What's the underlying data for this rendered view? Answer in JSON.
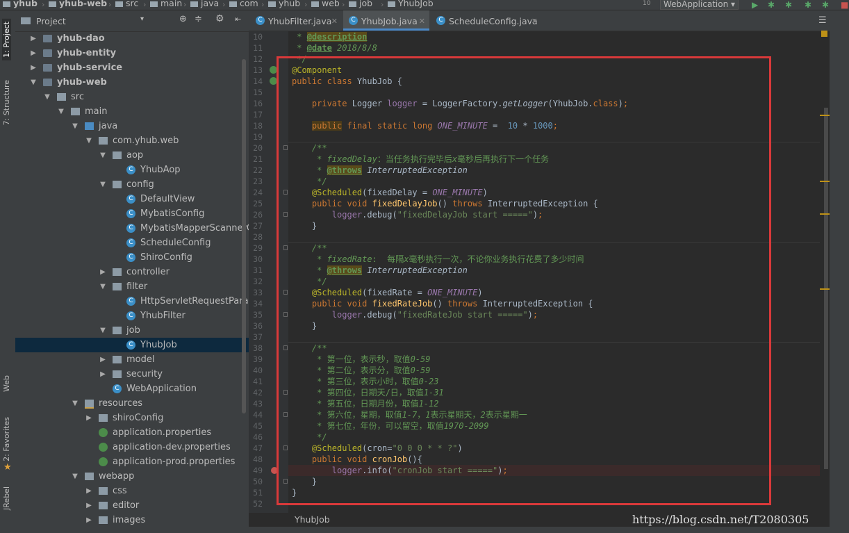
{
  "breadcrumbs": [
    {
      "label": "yhub",
      "bold": true
    },
    {
      "label": "yhub-web",
      "bold": true
    },
    {
      "label": "src",
      "bold": false
    },
    {
      "label": "main",
      "bold": false
    },
    {
      "label": "java",
      "bold": false
    },
    {
      "label": "com",
      "bold": false
    },
    {
      "label": "yhub",
      "bold": false
    },
    {
      "label": "web",
      "bold": false
    },
    {
      "label": "job",
      "bold": false
    },
    {
      "label": "YhubJob",
      "bold": false
    }
  ],
  "run_config": "WebApplication",
  "left_tool_tabs": [
    "1: Project",
    "7: Structure",
    "Web",
    "2: Favorites",
    "JRebel"
  ],
  "project_panel": {
    "title": "Project",
    "tree": [
      {
        "label": "yhub-dao",
        "indent": 0,
        "arrow": "right",
        "icon": "mod",
        "bold": true
      },
      {
        "label": "yhub-entity",
        "indent": 0,
        "arrow": "right",
        "icon": "mod",
        "bold": true
      },
      {
        "label": "yhub-service",
        "indent": 0,
        "arrow": "right",
        "icon": "mod",
        "bold": true
      },
      {
        "label": "yhub-web",
        "indent": 0,
        "arrow": "down",
        "icon": "mod",
        "bold": true
      },
      {
        "label": "src",
        "indent": 1,
        "arrow": "down",
        "icon": "fold",
        "bold": false
      },
      {
        "label": "main",
        "indent": 2,
        "arrow": "down",
        "icon": "fold",
        "bold": false
      },
      {
        "label": "java",
        "indent": 3,
        "arrow": "down",
        "icon": "src",
        "bold": false
      },
      {
        "label": "com.yhub.web",
        "indent": 4,
        "arrow": "down",
        "icon": "pkg",
        "bold": false
      },
      {
        "label": "aop",
        "indent": 5,
        "arrow": "down",
        "icon": "pkg",
        "bold": false
      },
      {
        "label": "YhubAop",
        "indent": 6,
        "arrow": "",
        "icon": "cls",
        "bold": false
      },
      {
        "label": "config",
        "indent": 5,
        "arrow": "down",
        "icon": "pkg",
        "bold": false
      },
      {
        "label": "DefaultView",
        "indent": 6,
        "arrow": "",
        "icon": "cls",
        "bold": false
      },
      {
        "label": "MybatisConfig",
        "indent": 6,
        "arrow": "",
        "icon": "cls",
        "bold": false
      },
      {
        "label": "MybatisMapperScannerCo",
        "indent": 6,
        "arrow": "",
        "icon": "cls",
        "bold": false
      },
      {
        "label": "ScheduleConfig",
        "indent": 6,
        "arrow": "",
        "icon": "cls",
        "bold": false
      },
      {
        "label": "ShiroConfig",
        "indent": 6,
        "arrow": "",
        "icon": "cls",
        "bold": false
      },
      {
        "label": "controller",
        "indent": 5,
        "arrow": "right",
        "icon": "pkg",
        "bold": false
      },
      {
        "label": "filter",
        "indent": 5,
        "arrow": "down",
        "icon": "pkg",
        "bold": false
      },
      {
        "label": "HttpServletRequestParame",
        "indent": 6,
        "arrow": "",
        "icon": "cls",
        "bold": false
      },
      {
        "label": "YhubFilter",
        "indent": 6,
        "arrow": "",
        "icon": "cls",
        "bold": false
      },
      {
        "label": "job",
        "indent": 5,
        "arrow": "down",
        "icon": "pkg",
        "bold": false
      },
      {
        "label": "YhubJob",
        "indent": 6,
        "arrow": "",
        "icon": "cls",
        "bold": false,
        "selected": true
      },
      {
        "label": "model",
        "indent": 5,
        "arrow": "right",
        "icon": "pkg",
        "bold": false
      },
      {
        "label": "security",
        "indent": 5,
        "arrow": "right",
        "icon": "pkg",
        "bold": false
      },
      {
        "label": "WebApplication",
        "indent": 5,
        "arrow": "",
        "icon": "cls",
        "bold": false
      },
      {
        "label": "resources",
        "indent": 3,
        "arrow": "down",
        "icon": "res",
        "bold": false
      },
      {
        "label": "shiroConfig",
        "indent": 4,
        "arrow": "right",
        "icon": "fold",
        "bold": false
      },
      {
        "label": "application.properties",
        "indent": 4,
        "arrow": "",
        "icon": "prop",
        "bold": false
      },
      {
        "label": "application-dev.properties",
        "indent": 4,
        "arrow": "",
        "icon": "prop",
        "bold": false
      },
      {
        "label": "application-prod.properties",
        "indent": 4,
        "arrow": "",
        "icon": "prop",
        "bold": false
      },
      {
        "label": "webapp",
        "indent": 3,
        "arrow": "down",
        "icon": "fold",
        "bold": false
      },
      {
        "label": "css",
        "indent": 4,
        "arrow": "right",
        "icon": "fold",
        "bold": false
      },
      {
        "label": "editor",
        "indent": 4,
        "arrow": "right",
        "icon": "fold",
        "bold": false
      },
      {
        "label": "images",
        "indent": 4,
        "arrow": "right",
        "icon": "fold",
        "bold": false
      }
    ]
  },
  "editor_tabs": [
    {
      "label": "YhubFilter.java",
      "active": false
    },
    {
      "label": "YhubJob.java",
      "active": true
    },
    {
      "label": "ScheduleConfig.java",
      "active": false
    }
  ],
  "code_lines": [
    {
      "n": 10,
      "html": "<span class=\"cmt\"> * </span><span class=\"tag\">@description</span>"
    },
    {
      "n": 11,
      "html": "<span class=\"cmt\"> * </span><span class=\"tag\" style=\"background:none\">@date</span><span class=\"cmt\"> 2018/8/8</span>"
    },
    {
      "n": 12,
      "html": "<span class=\"cmt\"> */</span>"
    },
    {
      "n": 13,
      "html": "<span class=\"ann\">@Component</span>"
    },
    {
      "n": 14,
      "html": "<span class=\"kw\">public class </span>YhubJob {"
    },
    {
      "n": 15,
      "html": ""
    },
    {
      "n": 16,
      "html": "    <span class=\"kw\">private </span>Logger <span class=\"fld\">logger</span> = LoggerFactory.<span class=\"it\">getLogger</span>(YhubJob.<span class=\"kw\">class</span>)<span class=\"kw\">;</span>"
    },
    {
      "n": 17,
      "html": ""
    },
    {
      "n": 18,
      "html": "    <span class=\"hlkw\">public</span><span class=\"kw\"> final static long </span><span class=\"cst\">ONE_MINUTE</span> =  <span class=\"num\">10</span> * <span class=\"num\">1000</span><span class=\"kw\">;</span>"
    },
    {
      "n": 19,
      "html": ""
    },
    {
      "n": 20,
      "html": "    <span class=\"cmt\">/**</span>"
    },
    {
      "n": 21,
      "html": "<span class=\"cmt\">     * fixedDelay</span><span class=\"cmtn\">：当任务执行完毕后</span><span class=\"cmt\">x</span><span class=\"cmtn\">毫秒后再执行下一个任务</span>"
    },
    {
      "n": 22,
      "html": "<span class=\"cmt\">     * </span><span class=\"tag\">@throws</span><span class=\"cmt\" style=\"color:#a9b7c6\"> InterruptedException</span>"
    },
    {
      "n": 23,
      "html": "<span class=\"cmt\">     */</span>"
    },
    {
      "n": 24,
      "html": "    <span class=\"ann\">@Scheduled</span>(fixedDelay = <span class=\"cst\">ONE_MINUTE</span>)"
    },
    {
      "n": 25,
      "html": "    <span class=\"kw\">public void </span><span class=\"mth\">fixedDelayJob</span>() <span class=\"kw\">throws </span>InterruptedException {"
    },
    {
      "n": 26,
      "html": "        <span class=\"fld\">logger</span>.debug(<span class=\"str\">\"fixedDelayJob start =====\"</span>)<span class=\"kw\">;</span>"
    },
    {
      "n": 27,
      "html": "    }"
    },
    {
      "n": 28,
      "html": ""
    },
    {
      "n": 29,
      "html": "    <span class=\"cmt\">/**</span>"
    },
    {
      "n": 30,
      "html": "<span class=\"cmt\">     * fixedRate</span><span class=\"cmtn\">:  每隔</span><span class=\"cmt\">x</span><span class=\"cmtn\">毫秒执行一次，不论你业务执行花费了多少时间</span>"
    },
    {
      "n": 31,
      "html": "<span class=\"cmt\">     * </span><span class=\"tag\">@throws</span><span class=\"cmt\" style=\"color:#a9b7c6\"> InterruptedException</span>"
    },
    {
      "n": 32,
      "html": "<span class=\"cmt\">     */</span>"
    },
    {
      "n": 33,
      "html": "    <span class=\"ann\">@Scheduled</span>(fixedRate = <span class=\"cst\">ONE_MINUTE</span>)"
    },
    {
      "n": 34,
      "html": "    <span class=\"kw\">public void </span><span class=\"mth\">fixedRateJob</span>() <span class=\"kw\">throws </span>InterruptedException {"
    },
    {
      "n": 35,
      "html": "        <span class=\"fld\">logger</span>.debug(<span class=\"str\">\"fixedRateJob start =====\"</span>)<span class=\"kw\">;</span>"
    },
    {
      "n": 36,
      "html": "    }"
    },
    {
      "n": 37,
      "html": ""
    },
    {
      "n": 38,
      "html": "    <span class=\"cmt\">/**</span>"
    },
    {
      "n": 39,
      "html": "<span class=\"cmtn\">     * 第一位，表示秒，取值</span><span class=\"cmt\">0-59</span>"
    },
    {
      "n": 40,
      "html": "<span class=\"cmtn\">     * 第二位，表示分，取值</span><span class=\"cmt\">0-59</span>"
    },
    {
      "n": 41,
      "html": "<span class=\"cmtn\">     * 第三位，表示小时，取值</span><span class=\"cmt\">0-23</span>"
    },
    {
      "n": 42,
      "html": "<span class=\"cmtn\">     * 第四位，日期天/日，取值</span><span class=\"cmt\">1-31</span>"
    },
    {
      "n": 43,
      "html": "<span class=\"cmtn\">     * 第五位，日期月份，取值</span><span class=\"cmt\">1-12</span>"
    },
    {
      "n": 44,
      "html": "<span class=\"cmtn\">     * 第六位，星期，取值</span><span class=\"cmt\">1-7</span><span class=\"cmtn\">，</span><span class=\"cmt\">1</span><span class=\"cmtn\">表示星期天，</span><span class=\"cmt\">2</span><span class=\"cmtn\">表示星期一</span>"
    },
    {
      "n": 45,
      "html": "<span class=\"cmtn\">     * 第七位，年份，可以留空，取值</span><span class=\"cmt\">1970-2099</span>"
    },
    {
      "n": 46,
      "html": "<span class=\"cmt\">     */</span>"
    },
    {
      "n": 47,
      "html": "    <span class=\"ann\">@Scheduled</span>(cron=<span class=\"str\">\"0 0 0 * * ?\"</span>)"
    },
    {
      "n": 48,
      "html": "    <span class=\"kw\">public void </span><span class=\"mth\">cronJob</span>(){"
    },
    {
      "n": 49,
      "html": "        <span class=\"fld\">logger</span>.info(<span class=\"str\">\"cronJob start =====\"</span>)<span class=\"kw\">;</span>"
    },
    {
      "n": 50,
      "html": "    }"
    },
    {
      "n": 51,
      "html": "}"
    },
    {
      "n": 52,
      "html": ""
    }
  ],
  "breakpoint_line": 49,
  "status_breadcrumb": "YhubJob",
  "watermark": "https://blog.csdn.net/T2080305",
  "colors": {
    "keyword": "#cc7832",
    "annotation": "#bbb529",
    "comment": "#629755",
    "string": "#6a8759",
    "highlight_box": "#d9393a"
  }
}
